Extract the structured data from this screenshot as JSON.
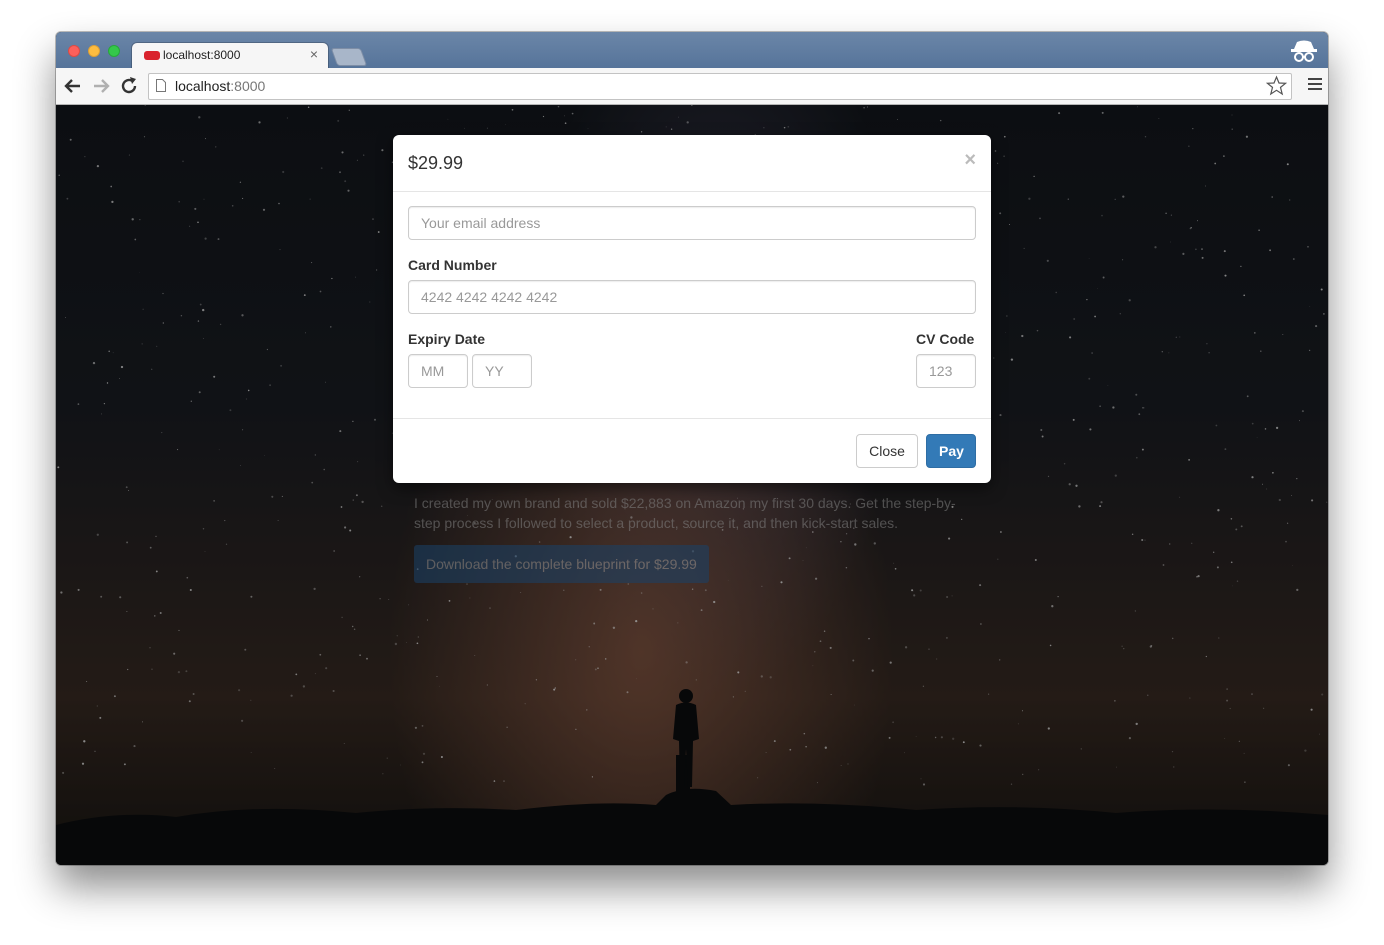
{
  "browser": {
    "tab_title": "localhost:8000",
    "tab_close": "×",
    "url_host": "localhost",
    "url_port": ":8000"
  },
  "hero": {
    "text": "I created my own brand and sold $22,883 on Amazon my first 30 days. Get the step-by-step process I followed to select a product, source it, and then kick-start sales.",
    "button": "Download the complete blueprint for $29.99"
  },
  "modal": {
    "title": "$29.99",
    "close_x": "×",
    "email_placeholder": "Your email address",
    "card_label": "Card Number",
    "card_placeholder": "4242 4242 4242 4242",
    "expiry_label": "Expiry Date",
    "month_placeholder": "MM",
    "year_placeholder": "YY",
    "cvc_label": "CV Code",
    "cvc_placeholder": "123",
    "close_button": "Close",
    "pay_button": "Pay"
  },
  "colors": {
    "primary": "#337ab7",
    "tab_bar": "#56749a"
  }
}
